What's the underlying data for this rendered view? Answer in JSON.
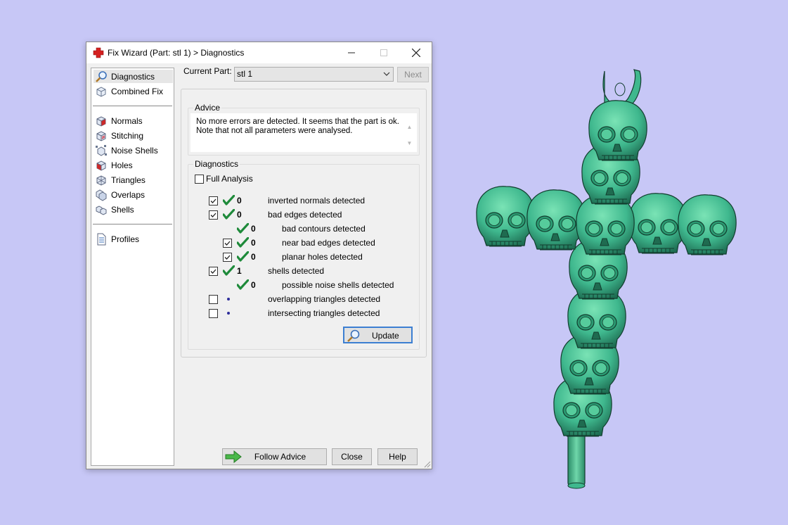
{
  "window": {
    "title": "Fix Wizard (Part: stl 1) > Diagnostics",
    "icon": "red-cross-icon"
  },
  "nav": {
    "top_items": [
      {
        "label": "Diagnostics",
        "icon": "magnifier-icon",
        "selected": true
      },
      {
        "label": "Combined Fix",
        "icon": "cube-outline-icon",
        "selected": false
      }
    ],
    "fix_items": [
      {
        "label": "Normals",
        "icon": "normals-cube-icon"
      },
      {
        "label": "Stitching",
        "icon": "stitching-cube-icon"
      },
      {
        "label": "Noise Shells",
        "icon": "noise-shells-icon"
      },
      {
        "label": "Holes",
        "icon": "holes-cube-icon"
      },
      {
        "label": "Triangles",
        "icon": "triangles-icon"
      },
      {
        "label": "Overlaps",
        "icon": "overlaps-icon"
      },
      {
        "label": "Shells",
        "icon": "shells-icon"
      }
    ],
    "profiles": {
      "label": "Profiles",
      "icon": "document-icon"
    }
  },
  "current_part": {
    "label": "Current Part:",
    "value": "stl 1",
    "next_label": "Next",
    "next_enabled": false
  },
  "advice": {
    "legend": "Advice",
    "line1": "No more errors are detected. It seems that the part is ok.",
    "line2": "Note that not all parameters were analysed."
  },
  "diagnostics": {
    "legend": "Diagnostics",
    "full_analysis_label": "Full Analysis",
    "full_analysis_checked": false,
    "rows": [
      {
        "checkbox": true,
        "checked": true,
        "status": "ok",
        "count": "0",
        "label": "inverted normals detected",
        "indent": 0
      },
      {
        "checkbox": true,
        "checked": true,
        "status": "ok",
        "count": "0",
        "label": "bad edges detected",
        "indent": 0
      },
      {
        "checkbox": false,
        "checked": false,
        "status": "ok",
        "count": "0",
        "label": "bad contours detected",
        "indent": 1
      },
      {
        "checkbox": true,
        "checked": true,
        "status": "ok",
        "count": "0",
        "label": "near bad edges detected",
        "indent": 1
      },
      {
        "checkbox": true,
        "checked": true,
        "status": "ok",
        "count": "0",
        "label": "planar holes detected",
        "indent": 1
      },
      {
        "checkbox": true,
        "checked": true,
        "status": "ok",
        "count": "1",
        "label": "shells detected",
        "indent": 0
      },
      {
        "checkbox": false,
        "checked": false,
        "status": "ok",
        "count": "0",
        "label": "possible noise shells detected",
        "indent": 1
      },
      {
        "checkbox": true,
        "checked": false,
        "status": "pending",
        "count": "",
        "label": "overlapping triangles detected",
        "indent": 0
      },
      {
        "checkbox": true,
        "checked": false,
        "status": "pending",
        "count": "",
        "label": "intersecting triangles detected",
        "indent": 0
      }
    ],
    "update_label": "Update"
  },
  "buttons": {
    "follow_advice": "Follow Advice",
    "close": "Close",
    "help": "Help"
  },
  "colors": {
    "background": "#c7c7f6",
    "model": "#3fb88e",
    "check": "#1e8a3a",
    "focus_border": "#3c7fd2"
  }
}
